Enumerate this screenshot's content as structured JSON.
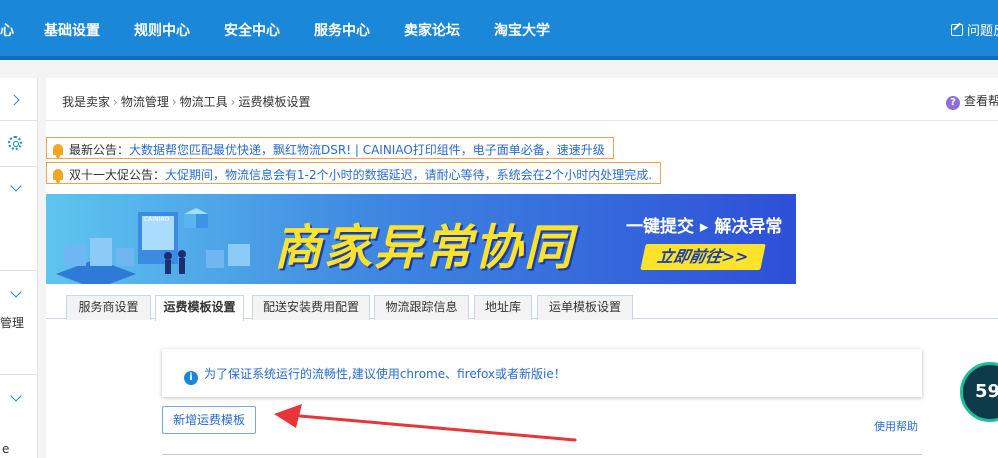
{
  "topnav": {
    "items": [
      "心",
      "基础设置",
      "规则中心",
      "安全中心",
      "服务中心",
      "卖家论坛",
      "淘宝大学"
    ],
    "feedback_label": "问题反"
  },
  "sidebar": {
    "text1": "管理",
    "text2": "e"
  },
  "breadcrumb": {
    "items": [
      "我是卖家",
      "物流管理",
      "物流工具",
      "运费模板设置"
    ],
    "separator": "›"
  },
  "help_top": "查看帮",
  "notices": [
    {
      "label": "最新公告：",
      "text": "大数据帮您匹配最优快递，飘红物流DSR! | CAINIAO打印组件，电子面单必备，速速升级"
    },
    {
      "label": "双十一大促公告：",
      "text": "大促期间，物流信息会有1-2个小时的数据延迟，请耐心等待，系统会在2个小时内处理完成."
    }
  ],
  "banner": {
    "title": "商家异常协同",
    "subtitle": "一键提交 ▸ 解决异常",
    "cta": "立即前往>>",
    "logo_text": "CAINIAO"
  },
  "tabs": [
    {
      "label": "服务商设置",
      "active": false
    },
    {
      "label": "运费模板设置",
      "active": true
    },
    {
      "label": "配送安装费用配置",
      "active": false
    },
    {
      "label": "物流跟踪信息",
      "active": false
    },
    {
      "label": "地址库",
      "active": false
    },
    {
      "label": "运单模板设置",
      "active": false
    }
  ],
  "info": {
    "icon": "info-icon",
    "text": "为了保证系统运行的流畅性,建议使用chrome、firefox或者新版ie！"
  },
  "actions": {
    "add_template": "新增运费模板",
    "help": "使用帮助"
  },
  "widget": {
    "value": "59"
  },
  "colors": {
    "nav_bg": "#1a87d8",
    "link": "#2a6bd1",
    "notice_border": "#f0a24f",
    "arrow": "#e8353a"
  }
}
